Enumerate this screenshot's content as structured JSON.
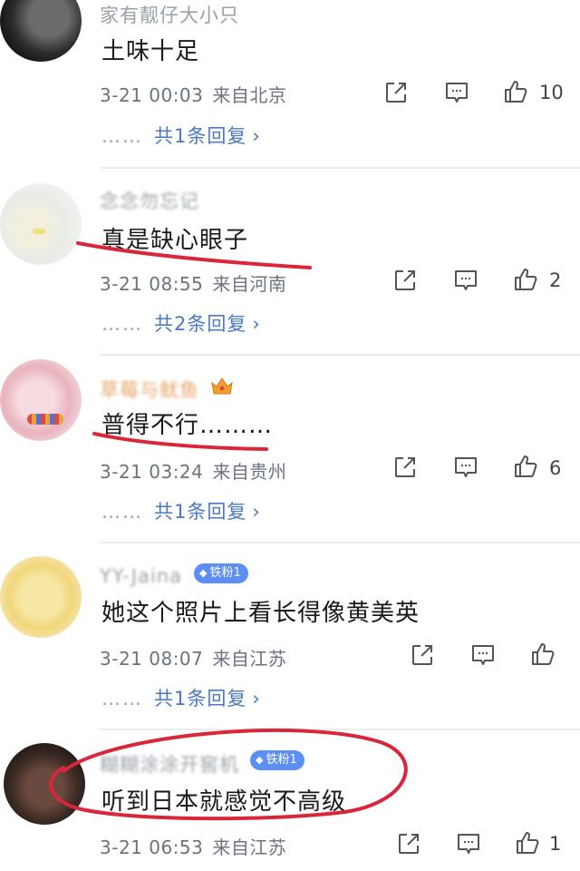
{
  "comments": [
    {
      "username": "家有靓仔大小只",
      "text": "土味十足",
      "time": "3-21 00:03",
      "location": "来自北京",
      "likes": "10",
      "replies": "共1条回复"
    },
    {
      "username": "念念勿忘记",
      "text": "真是缺心眼子",
      "time": "3-21 08:55",
      "location": "来自河南",
      "likes": "2",
      "replies": "共2条回复"
    },
    {
      "username": "草莓与鱿鱼",
      "text": "普得不行………",
      "time": "3-21 03:24",
      "location": "来自贵州",
      "likes": "6",
      "replies": "共1条回复"
    },
    {
      "username": "YY-Jaina",
      "badge": "铁粉1",
      "text": "她这个照片上看长得像黄美英",
      "time": "3-21 08:07",
      "location": "来自江苏",
      "likes": "",
      "replies": "共1条回复"
    },
    {
      "username": "糊糊涂涂开窖机",
      "badge": "铁粉1",
      "text": "听到日本就感觉不高级",
      "time": "3-21 06:53",
      "location": "来自江苏",
      "likes": "1",
      "replies": ""
    }
  ],
  "reply_prefix": "……",
  "icons": {
    "share": "share-icon",
    "comment": "comment-icon",
    "like": "thumbs-up-icon",
    "chevron": "chevron-right-icon"
  },
  "colors": {
    "link": "#4a78c2",
    "meta": "#6b7280",
    "annotation": "#d9263a",
    "badge": "#5b8ff3"
  }
}
